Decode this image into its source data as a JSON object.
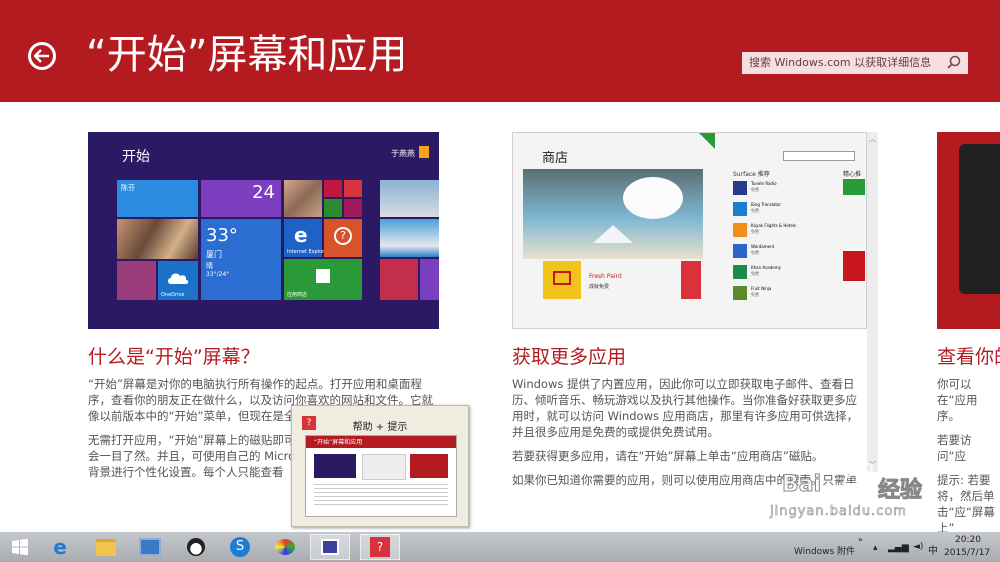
{
  "header": {
    "title": "“开始”屏幕和应用",
    "search_placeholder": "搜索 Windows.com 以获取详细信息",
    "bg_color": "#b31b21"
  },
  "columns": [
    {
      "title": "什么是“开始”屏幕？",
      "paragraphs": [
        "“开始”屏幕是对你的电脑执行所有操作的起点。打开应用和桌面程序，查看你的朋友正在做什么，以及访问你喜欢的网站和文件。它就像以前版本中的“开始”菜单，但现在是全屏的。",
        "无需打开应用，“开始”屏幕上的磁贴即可让你以及日历上的下一个约会一目了然。并且，可使用自己的 Microsoft 帐户登录，因此每色和背景进行个性化设置。每个人只能查看"
      ],
      "screenshot": {
        "heading": "开始",
        "user": "于燕燕",
        "tiles": {
          "contact_name": "陈芬",
          "calendar_day": "24",
          "weather_temp": "33°",
          "weather_city": "厦门",
          "weather_desc": "晴",
          "weather_range": "33°/24°",
          "onedrive": "OneDrive",
          "ie": "Internet Explorer",
          "store": "应用商店"
        }
      }
    },
    {
      "title": "获取更多应用",
      "paragraphs": [
        "Windows 提供了内置应用，因此你可以立即获取电子邮件、查看日历、倾听音乐、畅玩游戏以及执行其他操作。当你准备好获取更多应用时，就可以访问 Windows 应用商店，那里有许多应用可供选择，并且很多应用是免费的或提供免费试用。",
        "若要获得更多应用，请在“开始”屏幕上单击“应用商店”磁贴。",
        "如果你已知道你需要的应用，则可以使用应用商店中的搜索。只需单"
      ],
      "screenshot": {
        "heading": "商店",
        "featured_app": "Fresh Paint",
        "featured_sub": "成就免费",
        "list_header": "Surface 推荐",
        "side_header": "精心推",
        "apps": [
          "TuneIn Radio",
          "Bing Translator",
          "Kayak Flights & Hotels",
          "Wordament",
          "Khan Academy",
          "Fruit Ninja"
        ],
        "app_prices": [
          "免费",
          "免费",
          "免费",
          "免费",
          "免费",
          "免费"
        ]
      }
    },
    {
      "title": "查看你的",
      "paragraphs": [
        "你可以在“应用序。",
        "若要访问“应",
        "提示: 若要将，然后单击“应“屏幕上”"
      ]
    }
  ],
  "popup": {
    "title": "帮助 + 提示",
    "subtitle": "“开始”屏幕和应用"
  },
  "taskbar": {
    "windows_label": "Windows 附件",
    "time": "20:20",
    "date": "2015/7/17",
    "ime": "中"
  },
  "watermark": {
    "brand": "Bai",
    "brand_cn": "经验",
    "url": "jingyan.baidu.com"
  }
}
